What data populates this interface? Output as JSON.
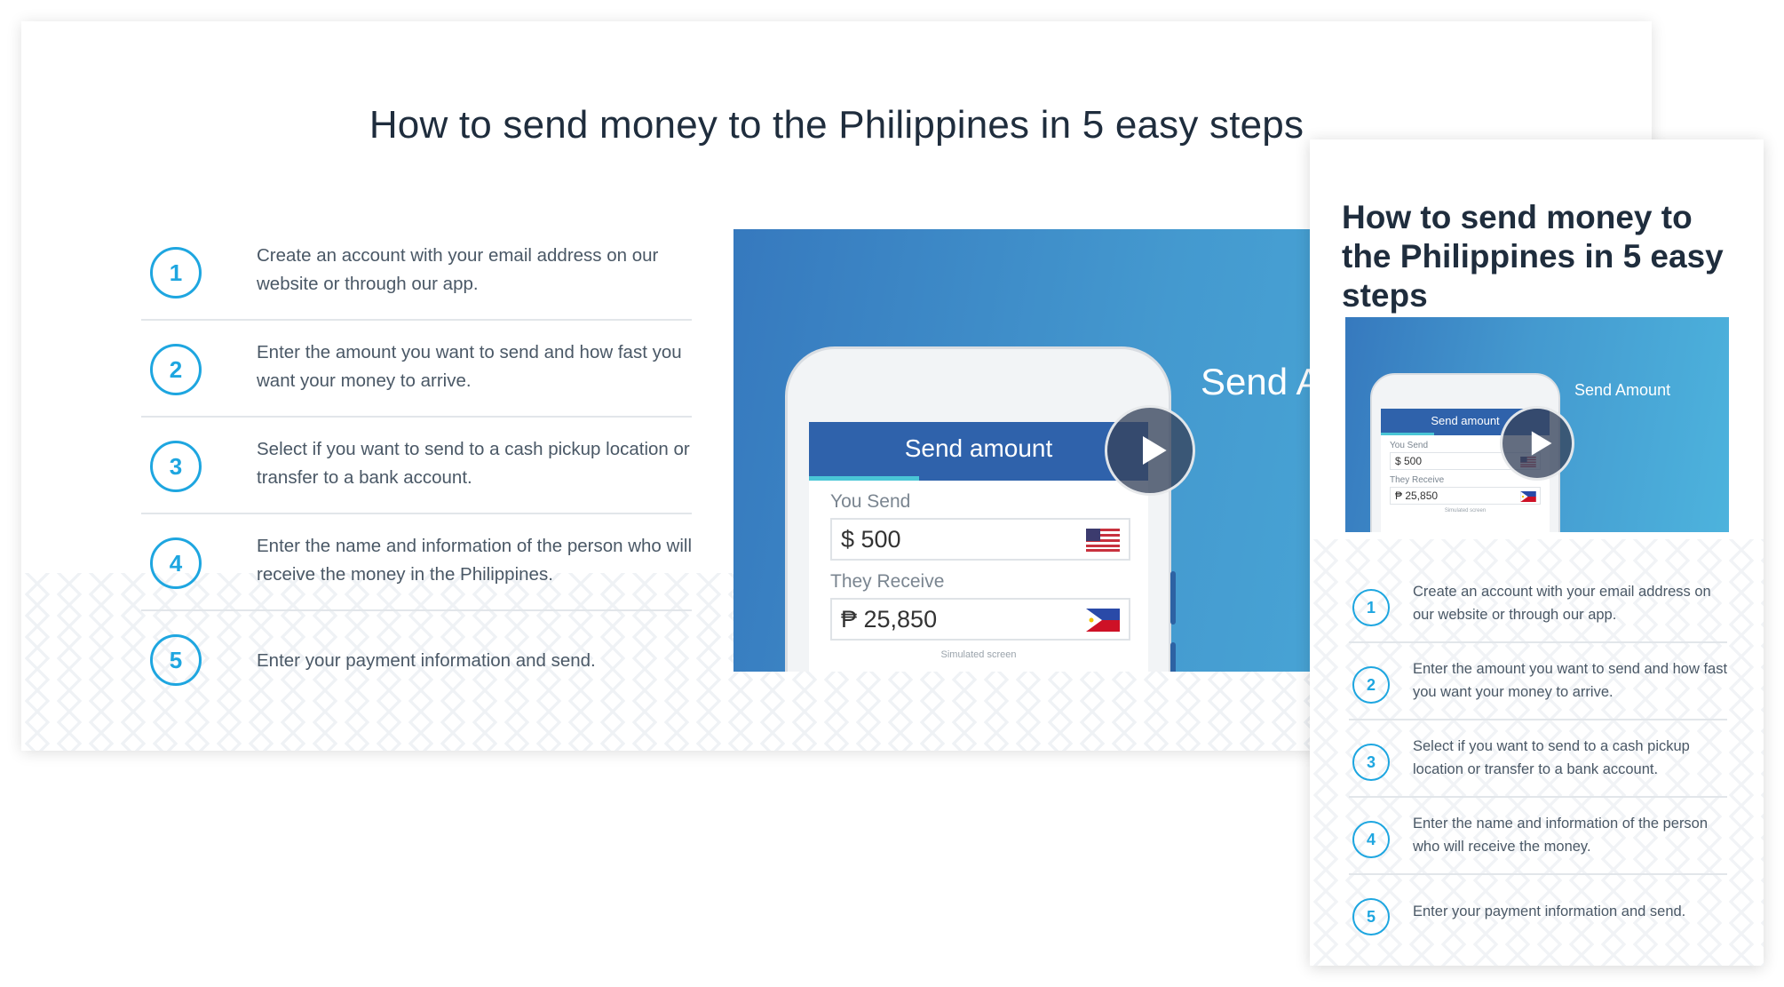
{
  "desktop": {
    "title": "How to send money to the Philippines in 5 easy steps",
    "steps": [
      {
        "num": "1",
        "text": "Create an account with your email address on our website or through our app."
      },
      {
        "num": "2",
        "text": "Enter the amount you want to send and how fast you want your money to arrive."
      },
      {
        "num": "3",
        "text": "Select if you want to send to a cash pickup location or transfer to a bank account."
      },
      {
        "num": "4",
        "text": "Enter the name and information of the person who will receive the money in the Philippines."
      },
      {
        "num": "5",
        "text": "Enter your payment information and send."
      }
    ],
    "video": {
      "screen_title": "Send amount",
      "you_send_label": "You Send",
      "you_send_value": "$ 500",
      "they_receive_label": "They Receive",
      "they_receive_value": "₱ 25,850",
      "simulated_note": "Simulated screen",
      "overlay_text": "Send A"
    }
  },
  "mobile": {
    "title": "How to send money to the Philippines in 5 easy steps",
    "video": {
      "screen_title": "Send amount",
      "you_send_label": "You Send",
      "you_send_value": "$ 500",
      "they_receive_label": "They Receive",
      "they_receive_value": "₱ 25,850",
      "simulated_note": "Simulated screen",
      "overlay_text": "Send Amount"
    },
    "steps": [
      {
        "num": "1",
        "text": "Create an account with your email address on our website or through our app."
      },
      {
        "num": "2",
        "text": "Enter the amount you want to send and how fast you want your money to arrive."
      },
      {
        "num": "3",
        "text": "Select if you want to send to a cash pickup location or transfer to a bank account."
      },
      {
        "num": "4",
        "text": "Enter the name and information of the person who will receive the money."
      },
      {
        "num": "5",
        "text": "Enter your payment information and send."
      }
    ]
  },
  "colors": {
    "accent": "#1ea6e0",
    "video_blue": "#3679be",
    "header_blue": "#2f62ab"
  },
  "icons": {
    "play": "play-icon",
    "us_flag": "us-flag-icon",
    "ph_flag": "ph-flag-icon"
  }
}
